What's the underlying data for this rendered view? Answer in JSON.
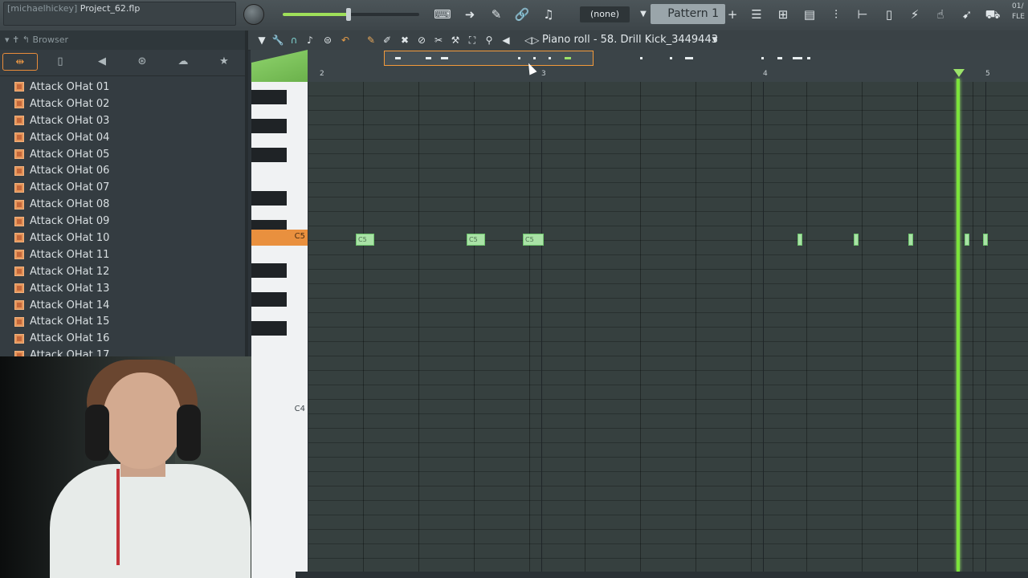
{
  "topbar": {
    "user_tag": "[michaelhickey]",
    "project_file": "Project_62.flp",
    "snap_value": "(none)",
    "pattern_label": "Pattern 1",
    "corner_line1": "01/",
    "corner_line2": "FLE",
    "master_volume_fraction": 0.48
  },
  "browser": {
    "title": "Browser",
    "files": [
      "Attack OHat 01",
      "Attack OHat 02",
      "Attack OHat 03",
      "Attack OHat 04",
      "Attack OHat 05",
      "Attack OHat 06",
      "Attack OHat 07",
      "Attack OHat 08",
      "Attack OHat 09",
      "Attack OHat 10",
      "Attack OHat 11",
      "Attack OHat 12",
      "Attack OHat 13",
      "Attack OHat 14",
      "Attack OHat 15",
      "Attack OHat 16",
      "Attack OHat 17"
    ]
  },
  "piano_roll": {
    "title": "Piano roll - 58. Drill Kick_3449443",
    "ruler_numbers": [
      "2",
      "3",
      "4",
      "5"
    ],
    "key_labels": [
      "C5",
      "C4"
    ],
    "note_label": "C5"
  }
}
